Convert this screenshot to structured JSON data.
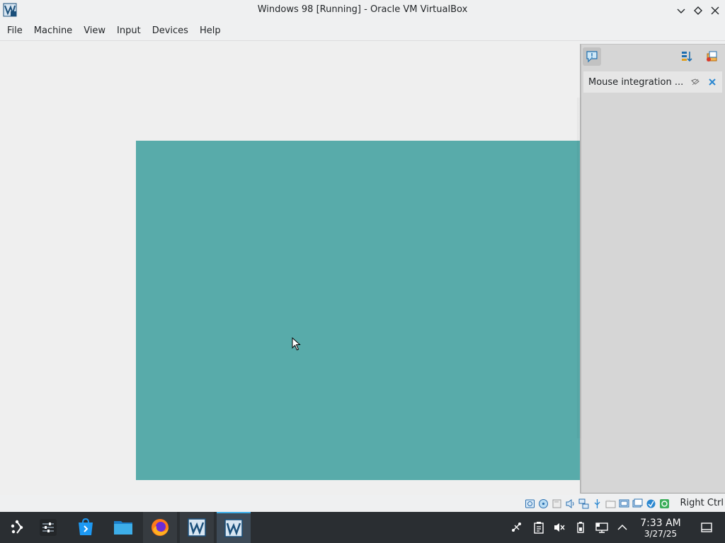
{
  "window": {
    "title": "Windows 98 [Running] - Oracle VM VirtualBox",
    "app_icon": "virtualbox-vm-icon",
    "controls": [
      "minimize-icon",
      "maximize-icon",
      "close-icon"
    ]
  },
  "menubar": {
    "items": [
      "File",
      "Machine",
      "View",
      "Input",
      "Devices",
      "Help"
    ]
  },
  "guest": {
    "background_color": "#58abaa"
  },
  "side_panel": {
    "toolbar_icons": [
      "notification-center-icon",
      "sort-notifications-icon",
      "keep-notifications-icon"
    ],
    "notification": {
      "text": "Mouse integration ...",
      "icons": [
        "mouse-integration-icon",
        "dismiss-icon"
      ]
    }
  },
  "statusbar": {
    "icons": [
      "hard-disk-icon",
      "optical-drive-icon",
      "floppy-drive-icon",
      "audio-icon",
      "network-icon",
      "usb-icon",
      "shared-folders-icon",
      "display-icon",
      "video-capture-icon",
      "guest-additions-icon",
      "mouse-integration-status-icon",
      "keyboard-capture-icon"
    ],
    "host_key": "Right Ctrl"
  },
  "taskbar": {
    "apps": [
      "application-launcher-icon",
      "system-settings-icon",
      "discover-store-icon",
      "file-manager-icon",
      "firefox-icon",
      "virtualbox-manager-icon",
      "virtualbox-vm-icon"
    ],
    "tray_icons": [
      "kde-connect-icon",
      "clipboard-icon",
      "audio-muted-icon",
      "battery-icon",
      "network-wired-icon",
      "expand-tray-icon"
    ],
    "time": "7:33 AM",
    "date": "3/27/25",
    "show_desktop_icon": "show-desktop-icon"
  },
  "colors": {
    "accent": "#3daee9",
    "taskbar": "#2a2e32",
    "window_bg": "#eff0f1"
  }
}
